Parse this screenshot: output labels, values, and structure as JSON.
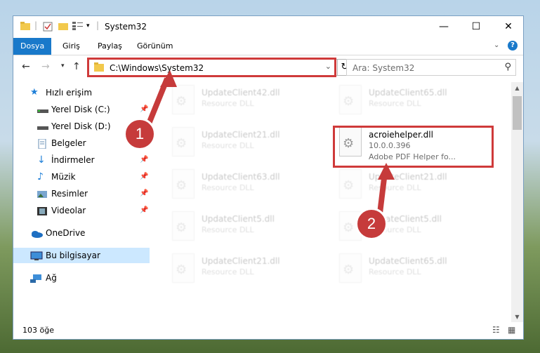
{
  "window": {
    "title": "System32",
    "controls": {
      "minimize": "—",
      "maximize": "☐",
      "close": "✕"
    }
  },
  "ribbon": {
    "tabs": [
      {
        "label": "Dosya",
        "active": true
      },
      {
        "label": "Giriş"
      },
      {
        "label": "Paylaş"
      },
      {
        "label": "Görünüm"
      }
    ]
  },
  "navigation": {
    "address": "C:\\Windows\\System32",
    "search_placeholder": "Ara: System32"
  },
  "sidebar": {
    "items": [
      {
        "label": "Hızlı erişim",
        "icon": "star-icon"
      },
      {
        "label": "Yerel Disk (C:)",
        "icon": "drive-icon",
        "pinned": true
      },
      {
        "label": "Yerel Disk (D:)",
        "icon": "drive-icon",
        "pinned": true
      },
      {
        "label": "Belgeler",
        "icon": "documents-icon",
        "pinned": true
      },
      {
        "label": "İndirmeler",
        "icon": "downloads-icon",
        "pinned": true
      },
      {
        "label": "Müzik",
        "icon": "music-icon",
        "pinned": true
      },
      {
        "label": "Resimler",
        "icon": "pictures-icon",
        "pinned": true
      },
      {
        "label": "Videolar",
        "icon": "videos-icon",
        "pinned": true
      },
      {
        "label": "OneDrive",
        "icon": "onedrive-icon"
      },
      {
        "label": "Bu bilgisayar",
        "icon": "computer-icon",
        "selected": true
      },
      {
        "label": "Ağ",
        "icon": "network-icon"
      }
    ]
  },
  "files": {
    "left": [
      {
        "name": "UpdateClient42.dll",
        "desc": "Resource DLL"
      },
      {
        "name": "UpdateClient21.dll",
        "desc": "Resource DLL"
      },
      {
        "name": "UpdateClient63.dll",
        "desc": "Resource DLL"
      },
      {
        "name": "UpdateClient5.dll",
        "desc": "Resource DLL"
      },
      {
        "name": "UpdateClient21.dll",
        "desc": "Resource DLL"
      }
    ],
    "right": [
      {
        "name": "UpdateClient65.dll",
        "desc": "Resource DLL"
      },
      {
        "name": "acroiehelper.dll",
        "desc": "10.0.0.396",
        "extra": "Adobe PDF Helper fo...",
        "highlighted": true
      },
      {
        "name": "UpdateClient21.dll",
        "desc": "Resource DLL"
      },
      {
        "name": "UpdateClient5.dll",
        "desc": "Resource DLL"
      },
      {
        "name": "UpdateClient65.dll",
        "desc": "Resource DLL"
      }
    ]
  },
  "status": {
    "item_count": "103 öğe"
  },
  "annotations": {
    "badge1": "1",
    "badge2": "2",
    "color": "#c63b3b"
  }
}
